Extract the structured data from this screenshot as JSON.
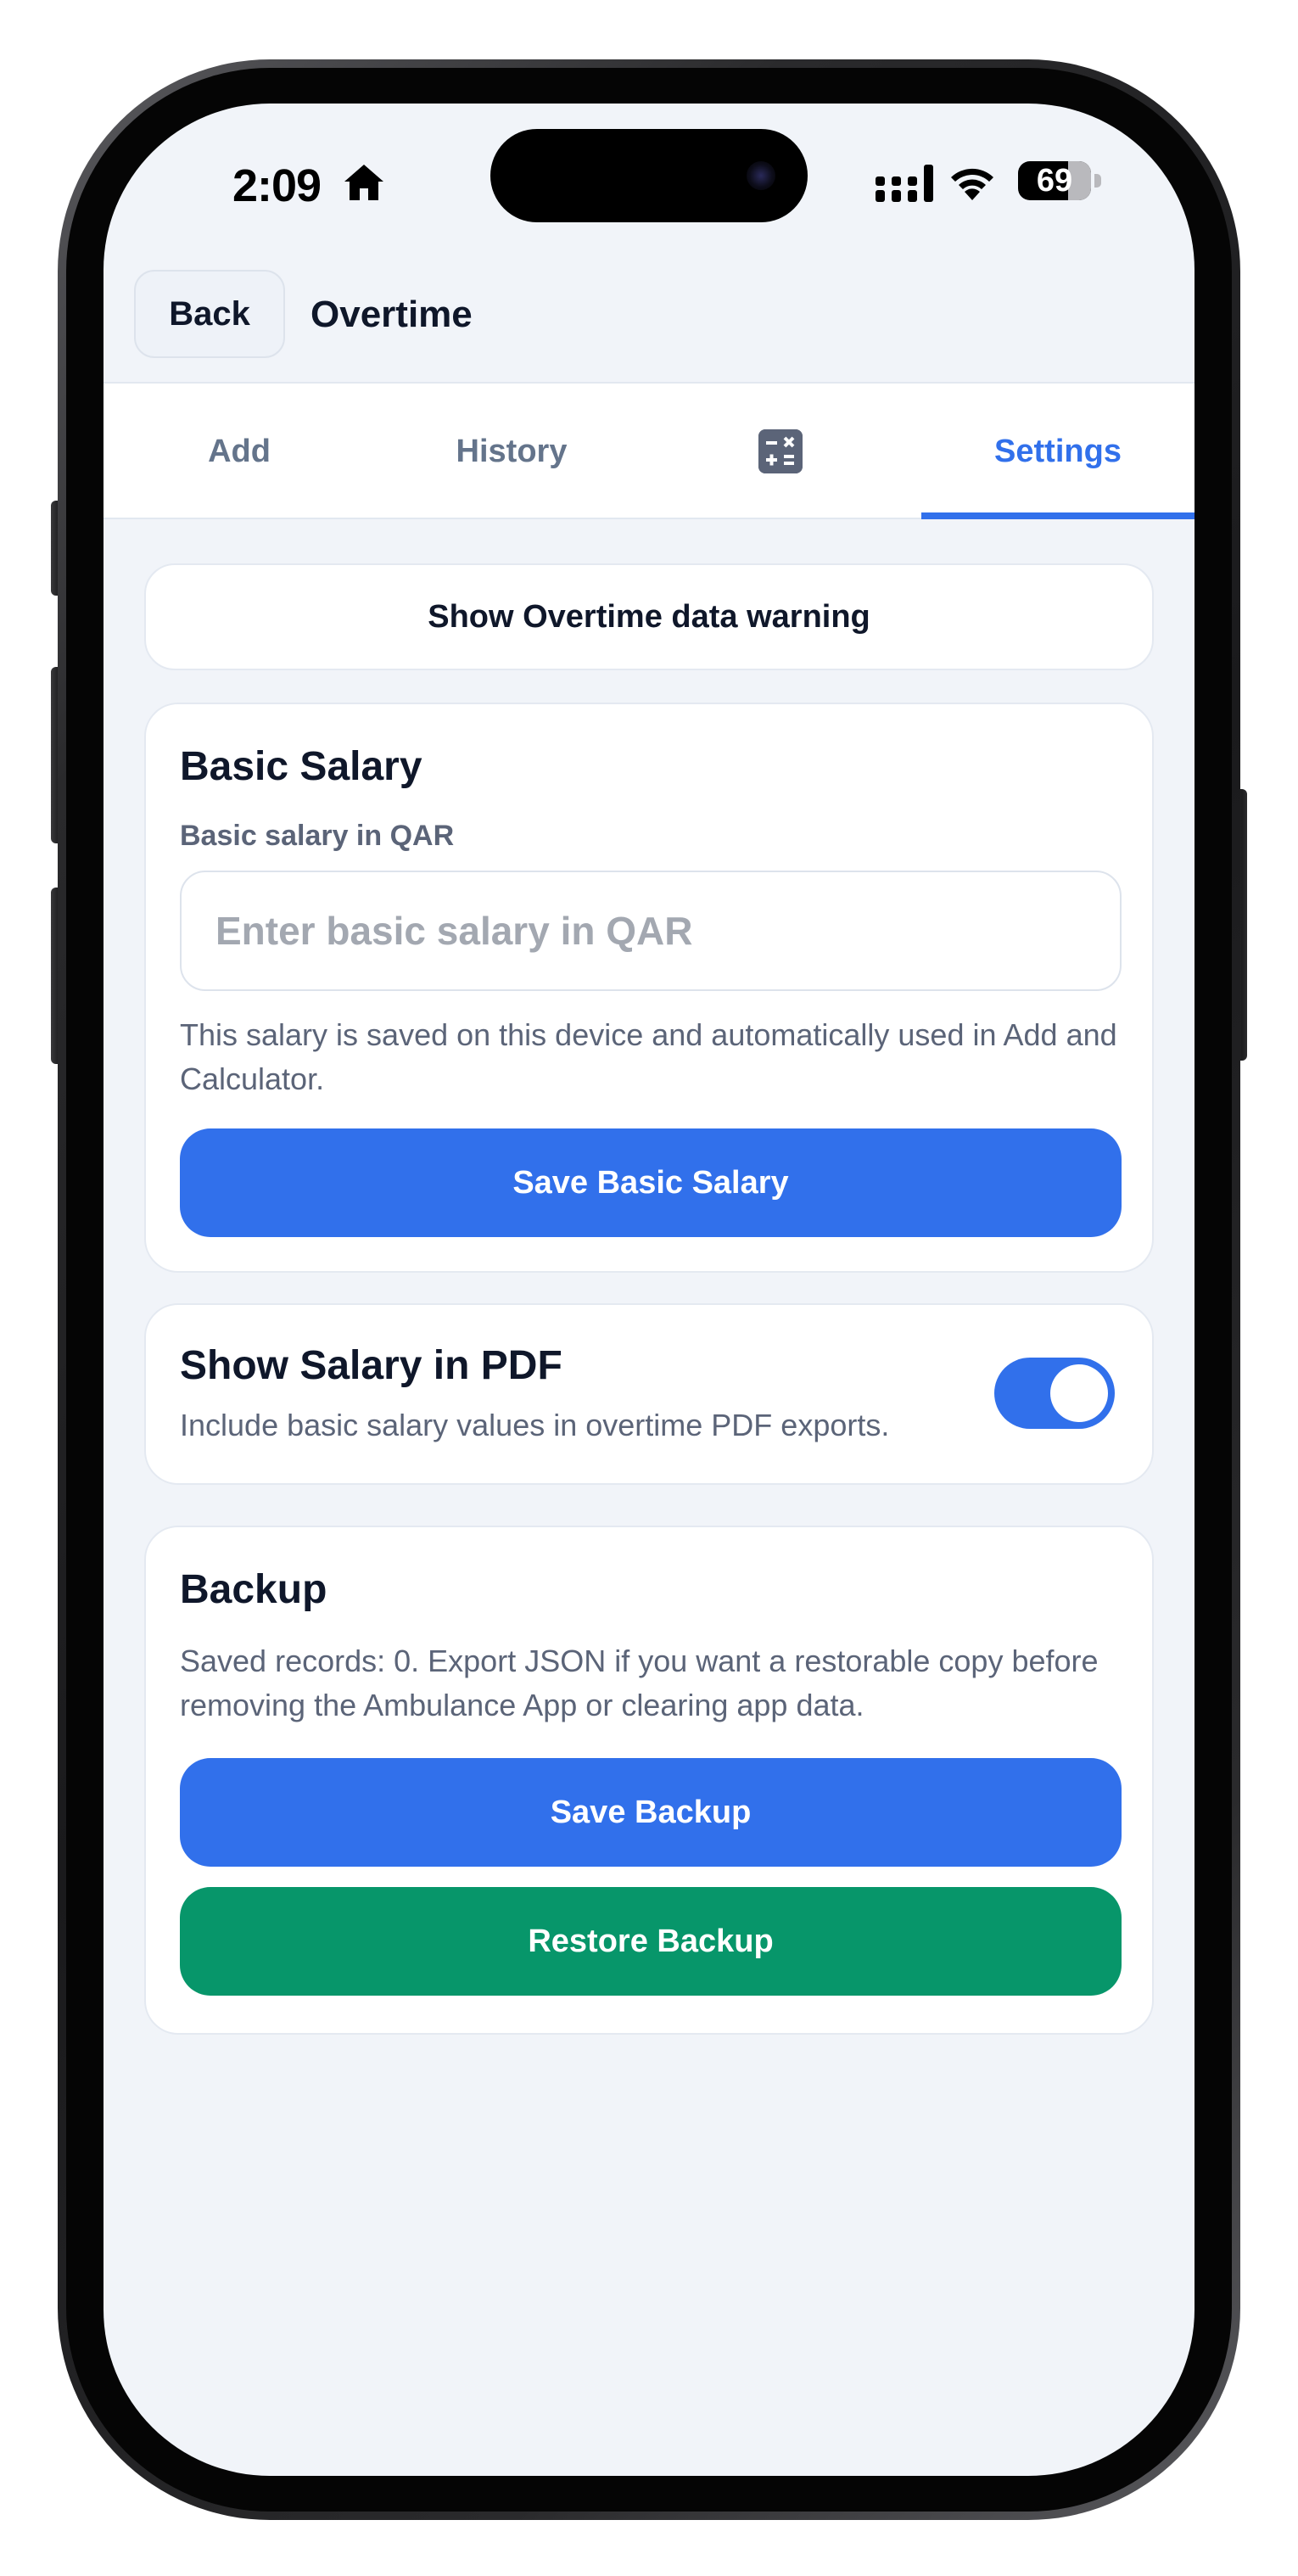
{
  "status_bar": {
    "time": "2:09",
    "battery_percent": "69",
    "battery_level": 0.69,
    "icons": [
      "home-icon",
      "signal-icon",
      "wifi-icon",
      "battery-icon"
    ]
  },
  "header": {
    "back_label": "Back",
    "title": "Overtime"
  },
  "tabs": {
    "items": [
      {
        "label": "Add",
        "active": false
      },
      {
        "label": "History",
        "active": false
      },
      {
        "label": "",
        "icon": "calculator-icon",
        "active": false
      },
      {
        "label": "Settings",
        "active": true
      }
    ]
  },
  "warning": {
    "button_label": "Show Overtime data warning"
  },
  "salary": {
    "title": "Basic Salary",
    "field_label": "Basic salary in QAR",
    "input_value": "",
    "placeholder": "Enter basic salary in QAR",
    "help_text": "This salary is saved on this device and automatically used in Add and Calculator.",
    "save_label": "Save Basic Salary"
  },
  "pdf": {
    "title": "Show Salary in PDF",
    "description": "Include basic salary values in overtime PDF exports.",
    "enabled": true
  },
  "backup": {
    "title": "Backup",
    "description": "Saved records: 0. Export JSON if you want a restorable copy before removing the Ambulance App or clearing app data.",
    "save_label": "Save Backup",
    "restore_label": "Restore Backup"
  },
  "colors": {
    "accent": "#3170eb",
    "success": "#07966a",
    "background": "#f1f4f9",
    "text_primary": "#0f172a",
    "text_secondary": "#5b6478"
  }
}
